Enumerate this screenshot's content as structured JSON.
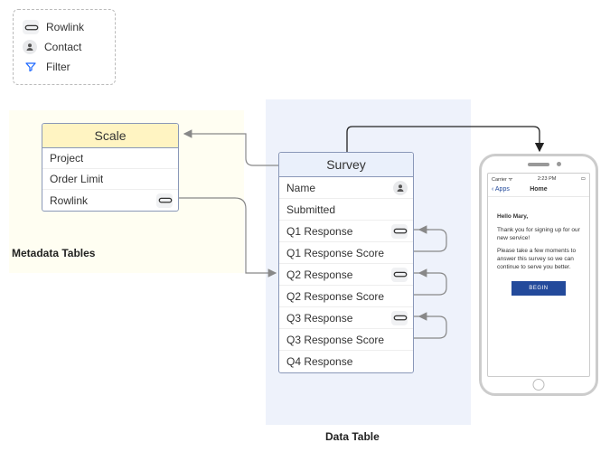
{
  "legend": {
    "items": [
      {
        "icon": "rowlink",
        "label": "Rowlink"
      },
      {
        "icon": "contact",
        "label": "Contact"
      },
      {
        "icon": "filter",
        "label": "Filter"
      }
    ]
  },
  "panels": {
    "metadata_label": "Metadata Tables",
    "data_label": "Data Table"
  },
  "tables": {
    "scale": {
      "title": "Scale",
      "rows": [
        {
          "label": "Project",
          "icon": null
        },
        {
          "label": "Order Limit",
          "icon": null
        },
        {
          "label": "Rowlink",
          "icon": "rowlink"
        }
      ]
    },
    "survey": {
      "title": "Survey",
      "rows": [
        {
          "label": "Name",
          "icon": "contact"
        },
        {
          "label": "Submitted",
          "icon": null
        },
        {
          "label": "Q1 Response",
          "icon": "rowlink"
        },
        {
          "label": "Q1 Response Score",
          "icon": null
        },
        {
          "label": "Q2 Response",
          "icon": "rowlink"
        },
        {
          "label": "Q2 Response Score",
          "icon": null
        },
        {
          "label": "Q3 Response",
          "icon": "rowlink"
        },
        {
          "label": "Q3 Response Score",
          "icon": null
        },
        {
          "label": "Q4 Response",
          "icon": null
        }
      ]
    }
  },
  "phone": {
    "status": {
      "carrier": "Carrier",
      "wifi": "ᯤ",
      "time": "2:23 PM",
      "battery": "▭"
    },
    "nav": {
      "back": "Apps",
      "title": "Home"
    },
    "hello": "Hello Mary,",
    "p1": "Thank you for signing up for our new service!",
    "p2": "Please take a few moments to answer this survey so we can continue to serve you better.",
    "button": "BEGIN"
  }
}
